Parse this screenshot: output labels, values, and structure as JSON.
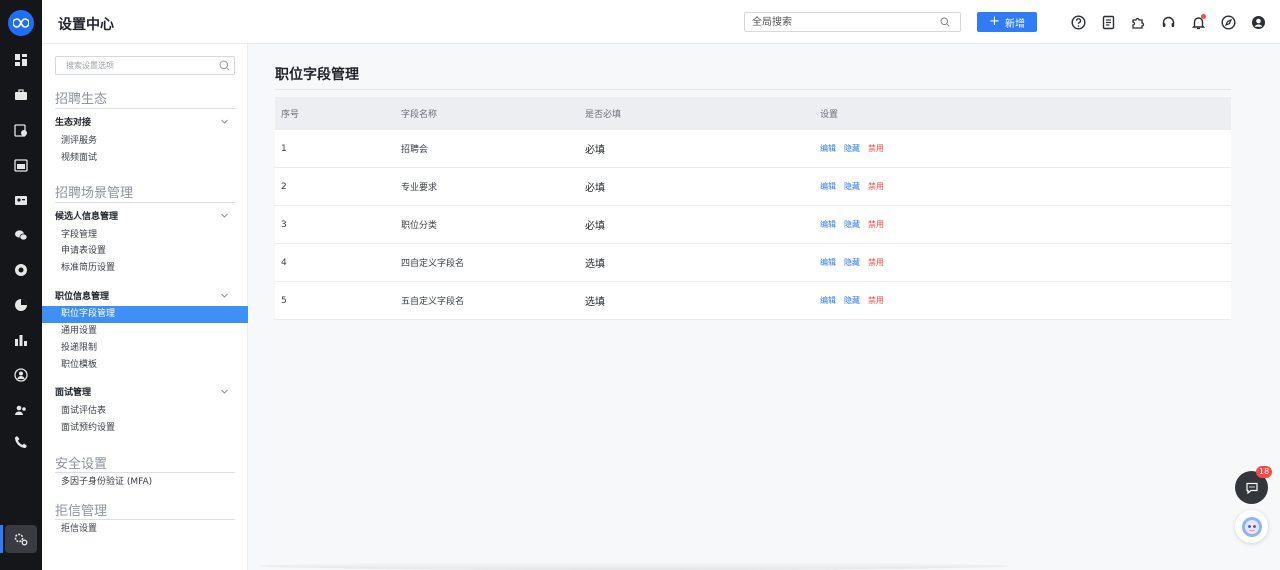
{
  "header": {
    "title": "设置中心",
    "search_placeholder": "全局搜索",
    "new_button_plus": "+",
    "new_button_label": "新增"
  },
  "sidebar": {
    "search_placeholder": "搜索设置选项",
    "sections": [
      {
        "title": "招聘生态",
        "groups": [
          {
            "label": "生态对接",
            "items": [
              "测评服务",
              "视频面试"
            ]
          }
        ]
      },
      {
        "title": "招聘场景管理",
        "groups": [
          {
            "label": "候选人信息管理",
            "items": [
              "字段管理",
              "申请表设置",
              "标准简历设置"
            ]
          },
          {
            "label": "职位信息管理",
            "items": [
              "职位字段管理",
              "通用设置",
              "投递限制",
              "职位模板"
            ]
          },
          {
            "label": "面试管理",
            "items": [
              "面试评估表",
              "面试预约设置"
            ]
          }
        ]
      },
      {
        "title": "安全设置",
        "groups": [],
        "items": [
          "多因子身份验证 (MFA)"
        ]
      },
      {
        "title": "拒信管理",
        "groups": [],
        "items": [
          "拒信设置"
        ]
      }
    ],
    "active_item": "职位字段管理"
  },
  "main": {
    "title": "职位字段管理",
    "columns": [
      "序号",
      "字段名称",
      "是否必填",
      "设置"
    ],
    "rows": [
      {
        "no": "1",
        "name": "招聘会",
        "required": "必填",
        "actions": [
          "编辑",
          "隐藏",
          "禁用"
        ]
      },
      {
        "no": "2",
        "name": "专业要求",
        "required": "必填",
        "actions": [
          "编辑",
          "隐藏",
          "禁用"
        ]
      },
      {
        "no": "3",
        "name": "职位分类",
        "required": "必填",
        "actions": [
          "编辑",
          "隐藏",
          "禁用"
        ]
      },
      {
        "no": "4",
        "name": "四自定义字段名",
        "required": "选填",
        "actions": [
          "编辑",
          "隐藏",
          "禁用"
        ]
      },
      {
        "no": "5",
        "name": "五自定义字段名",
        "required": "选填",
        "actions": [
          "编辑",
          "隐藏",
          "禁用"
        ]
      }
    ]
  },
  "floating": {
    "chat_badge": "18"
  },
  "icons": {
    "rail": [
      "dashboard-icon",
      "briefcase-icon",
      "job-calendar-icon",
      "schedule-icon",
      "contact-card-icon",
      "wechat-icon",
      "record-icon",
      "pie-chart-icon",
      "bar-chart-icon",
      "user-circle-icon",
      "team-icon",
      "phone-icon",
      "settings-icon"
    ],
    "header": [
      "help-icon",
      "document-icon",
      "puzzle-icon",
      "headset-icon",
      "bell-icon",
      "compass-icon",
      "profile-icon"
    ]
  },
  "colors": {
    "accent": "#2f7cf6",
    "active_item": "#3e8ff8",
    "danger": "#f54a45",
    "rail_bg": "#15161a"
  }
}
